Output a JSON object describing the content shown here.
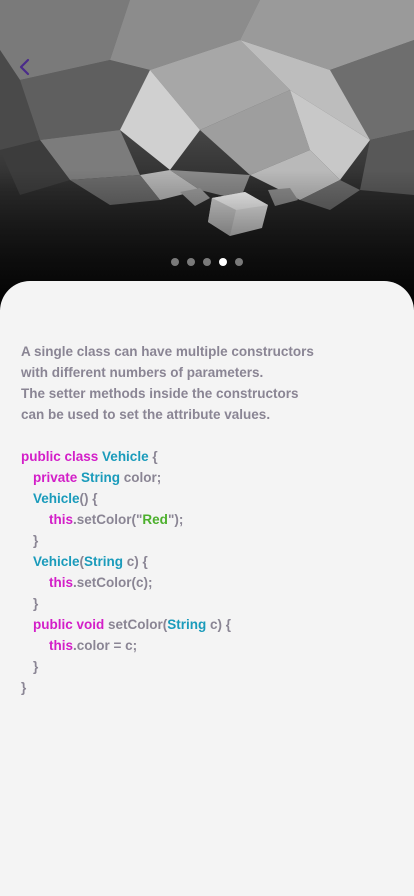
{
  "header": {
    "back_icon": "chevron-left-icon",
    "accent_color": "#4a2b8a"
  },
  "carousel": {
    "page_count": 5,
    "active_index": 3
  },
  "description": {
    "lines": [
      "A single class can have multiple constructors",
      "with different numbers of parameters.",
      "The setter methods inside the constructors",
      "can be used to set the attribute values."
    ]
  },
  "code": {
    "l1": {
      "kw": "public class ",
      "type": "Vehicle",
      "rest": " {"
    },
    "l2": {
      "kw": "private ",
      "type": "String",
      "rest": " color;"
    },
    "l3": {
      "type": "Vehicle",
      "rest": "() {"
    },
    "l4": {
      "kw": "this",
      "rest": ".setColor(\"",
      "str": "Red",
      "rest2": "\");"
    },
    "l5": {
      "rest": "}"
    },
    "l6": {
      "type": "Vehicle",
      "rest": "(",
      "type2": "String",
      "rest2": " c) {"
    },
    "l7": {
      "kw": "this",
      "rest": ".setColor(c);"
    },
    "l8": {
      "rest": "}"
    },
    "l9": {
      "kw": "public void ",
      "rest": "setColor(",
      "type": "String",
      "rest2": " c) {"
    },
    "l10": {
      "kw": "this",
      "rest": ".color = c;"
    },
    "l11": {
      "rest": "}"
    },
    "l12": {
      "rest": "}"
    }
  },
  "colors": {
    "text": "#8a8594",
    "keyword": "#d31ec8",
    "type": "#1a9bbb",
    "string": "#4cb02c"
  }
}
